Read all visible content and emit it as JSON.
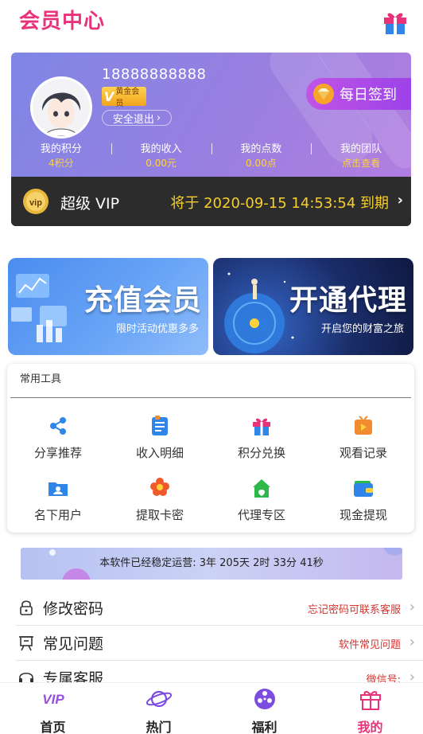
{
  "header": {
    "title": "会员中心",
    "gift_icon": "gift-icon"
  },
  "profile": {
    "phone": "18888888888",
    "badge_mark": "V",
    "badge_text": "黄金会员",
    "logout_label": "安全退出",
    "checkin_label": "每日签到"
  },
  "stats": [
    {
      "label": "我的积分",
      "value": "4积分"
    },
    {
      "label": "我的收入",
      "value": "0.00元"
    },
    {
      "label": "我的点数",
      "value": "0.00点"
    },
    {
      "label": "我的团队",
      "value": "点击查看"
    }
  ],
  "vip": {
    "icon_text": "vip",
    "level": "超级 VIP",
    "expire": "将于 2020-09-15 14:53:54 到期"
  },
  "banners": {
    "recharge": {
      "title": "充值会员",
      "subtitle": "限时活动优惠多多"
    },
    "agent": {
      "title": "开通代理",
      "subtitle": "开启您的财富之旅"
    }
  },
  "tools": {
    "title": "常用工具",
    "items": [
      {
        "label": "分享推荐",
        "icon": "share-icon"
      },
      {
        "label": "收入明细",
        "icon": "list-icon"
      },
      {
        "label": "积分兑换",
        "icon": "gift-icon"
      },
      {
        "label": "观看记录",
        "icon": "play-icon"
      },
      {
        "label": "名下用户",
        "icon": "folder-user-icon"
      },
      {
        "label": "提取卡密",
        "icon": "flower-icon"
      },
      {
        "label": "代理专区",
        "icon": "shop-icon"
      },
      {
        "label": "现金提现",
        "icon": "wallet-icon"
      }
    ]
  },
  "runtime": {
    "text": "本软件已经稳定运营: 3年 205天 2时 33分 41秒"
  },
  "menu": [
    {
      "label": "修改密码",
      "right": "忘记密码可联系客服",
      "icon": "lock-icon"
    },
    {
      "label": "常见问题",
      "right": "软件常见问题",
      "icon": "question-board-icon"
    },
    {
      "label": "专属客服",
      "right": "微信号:",
      "icon": "headset-icon"
    }
  ],
  "tabbar": [
    {
      "label": "首页",
      "icon": "vip-logo-icon",
      "color": "#222222"
    },
    {
      "label": "热门",
      "icon": "planet-icon",
      "color": "#222222"
    },
    {
      "label": "福利",
      "icon": "film-reel-icon",
      "color": "#222222"
    },
    {
      "label": "我的",
      "icon": "gift-outline-icon",
      "color": "#e8327a"
    }
  ],
  "colors": {
    "accent": "#e8327a",
    "gold": "#ffd23c",
    "vip_gold": "#f7cf2d",
    "dark_bar": "#2c2c2c"
  }
}
